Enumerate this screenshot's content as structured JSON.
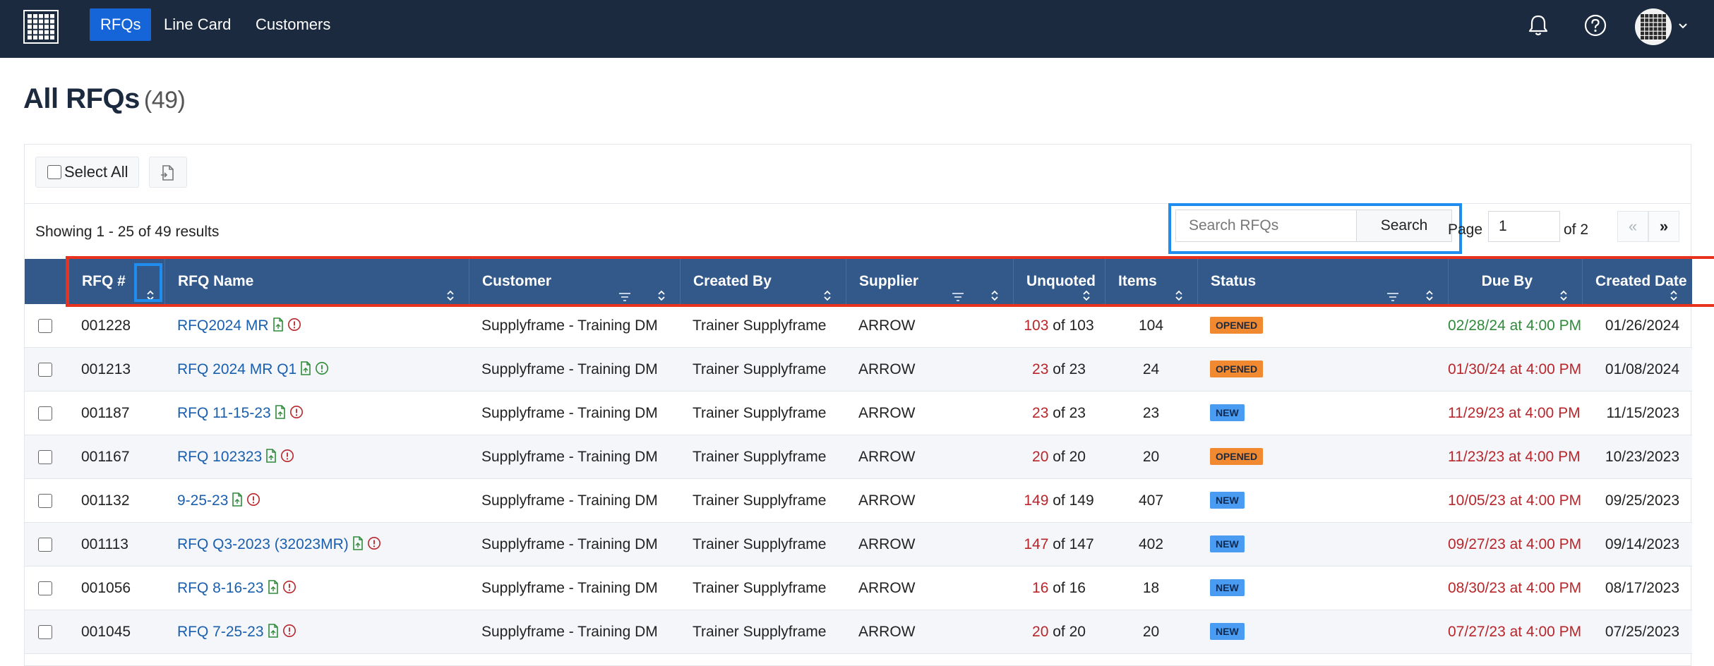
{
  "nav": {
    "links": [
      {
        "label": "RFQs",
        "active": true
      },
      {
        "label": "Line Card",
        "active": false
      },
      {
        "label": "Customers",
        "active": false
      }
    ],
    "icons": [
      "bell-icon",
      "help-icon",
      "avatar"
    ],
    "bg_color": "#1b2a3e",
    "active_color": "#1565d8"
  },
  "page": {
    "title": "All RFQs",
    "count": "(49)"
  },
  "toolbar": {
    "select_all_label": "Select All",
    "export_icon": "document-export-icon"
  },
  "results": {
    "text": "Showing 1 - 25 of 49 results"
  },
  "search": {
    "placeholder": "Search RFQs",
    "button_label": "Search"
  },
  "pagination": {
    "page_label": "Page",
    "current_page": "1",
    "of_label": "of 2",
    "prev_label": "«",
    "next_label": "»"
  },
  "table": {
    "header_color": "#33598a",
    "columns": [
      {
        "key": "rfq_no",
        "label": "RFQ #",
        "sortable": true,
        "filterable": false
      },
      {
        "key": "rfq_name",
        "label": "RFQ Name",
        "sortable": true,
        "filterable": false
      },
      {
        "key": "customer",
        "label": "Customer",
        "sortable": true,
        "filterable": true
      },
      {
        "key": "created_by",
        "label": "Created By",
        "sortable": true,
        "filterable": false
      },
      {
        "key": "supplier",
        "label": "Supplier",
        "sortable": true,
        "filterable": true
      },
      {
        "key": "unquoted",
        "label": "Unquoted CPNs",
        "sortable": true,
        "filterable": false
      },
      {
        "key": "items",
        "label": "Items",
        "sortable": true,
        "filterable": false
      },
      {
        "key": "status",
        "label": "Status",
        "sortable": true,
        "filterable": true
      },
      {
        "key": "due_by",
        "label": "Due By",
        "sortable": true,
        "filterable": false
      },
      {
        "key": "created_date",
        "label": "Created Date",
        "sortable": true,
        "filterable": false
      }
    ],
    "rows": [
      {
        "rfq_no": "001228",
        "rfq_name": "RFQ2024 MR",
        "info_color": "red",
        "customer": "Supplyframe - Training DM",
        "created_by": "Trainer Supplyframe",
        "supplier": "ARROW",
        "unquoted": "103",
        "unquoted_total": "of 103",
        "items": "104",
        "status": "OPENED",
        "due_by": "02/28/24 at 4:00 PM",
        "due_color": "green",
        "created_date": "01/26/2024"
      },
      {
        "rfq_no": "001213",
        "rfq_name": "RFQ 2024 MR Q1",
        "info_color": "green",
        "customer": "Supplyframe - Training DM",
        "created_by": "Trainer Supplyframe",
        "supplier": "ARROW",
        "unquoted": "23",
        "unquoted_total": "of 23",
        "items": "24",
        "status": "OPENED",
        "due_by": "01/30/24 at 4:00 PM",
        "due_color": "red",
        "created_date": "01/08/2024"
      },
      {
        "rfq_no": "001187",
        "rfq_name": "RFQ 11-15-23",
        "info_color": "red",
        "customer": "Supplyframe - Training DM",
        "created_by": "Trainer Supplyframe",
        "supplier": "ARROW",
        "unquoted": "23",
        "unquoted_total": "of 23",
        "items": "23",
        "status": "NEW",
        "due_by": "11/29/23 at 4:00 PM",
        "due_color": "red",
        "created_date": "11/15/2023"
      },
      {
        "rfq_no": "001167",
        "rfq_name": "RFQ 102323",
        "info_color": "red",
        "customer": "Supplyframe - Training DM",
        "created_by": "Trainer Supplyframe",
        "supplier": "ARROW",
        "unquoted": "20",
        "unquoted_total": "of 20",
        "items": "20",
        "status": "OPENED",
        "due_by": "11/23/23 at 4:00 PM",
        "due_color": "red",
        "created_date": "10/23/2023"
      },
      {
        "rfq_no": "001132",
        "rfq_name": "9-25-23",
        "info_color": "red",
        "customer": "Supplyframe - Training DM",
        "created_by": "Trainer Supplyframe",
        "supplier": "ARROW",
        "unquoted": "149",
        "unquoted_total": "of 149",
        "items": "407",
        "status": "NEW",
        "due_by": "10/05/23 at 4:00 PM",
        "due_color": "red",
        "created_date": "09/25/2023"
      },
      {
        "rfq_no": "001113",
        "rfq_name": "RFQ Q3-2023 (32023MR)",
        "info_color": "red",
        "customer": "Supplyframe - Training DM",
        "created_by": "Trainer Supplyframe",
        "supplier": "ARROW",
        "unquoted": "147",
        "unquoted_total": "of 147",
        "items": "402",
        "status": "NEW",
        "due_by": "09/27/23 at 4:00 PM",
        "due_color": "red",
        "created_date": "09/14/2023"
      },
      {
        "rfq_no": "001056",
        "rfq_name": "RFQ 8-16-23",
        "info_color": "red",
        "customer": "Supplyframe - Training DM",
        "created_by": "Trainer Supplyframe",
        "supplier": "ARROW",
        "unquoted": "16",
        "unquoted_total": "of 16",
        "items": "18",
        "status": "NEW",
        "due_by": "08/30/23 at 4:00 PM",
        "due_color": "red",
        "created_date": "08/17/2023"
      },
      {
        "rfq_no": "001045",
        "rfq_name": "RFQ 7-25-23",
        "info_color": "red",
        "customer": "Supplyframe - Training DM",
        "created_by": "Trainer Supplyframe",
        "supplier": "ARROW",
        "unquoted": "20",
        "unquoted_total": "of 20",
        "items": "20",
        "status": "NEW",
        "due_by": "07/27/23 at 4:00 PM",
        "due_color": "red",
        "created_date": "07/25/2023"
      }
    ]
  },
  "highlights": {
    "red_color": "#e8321e",
    "blue_color": "#1f8cf0"
  }
}
